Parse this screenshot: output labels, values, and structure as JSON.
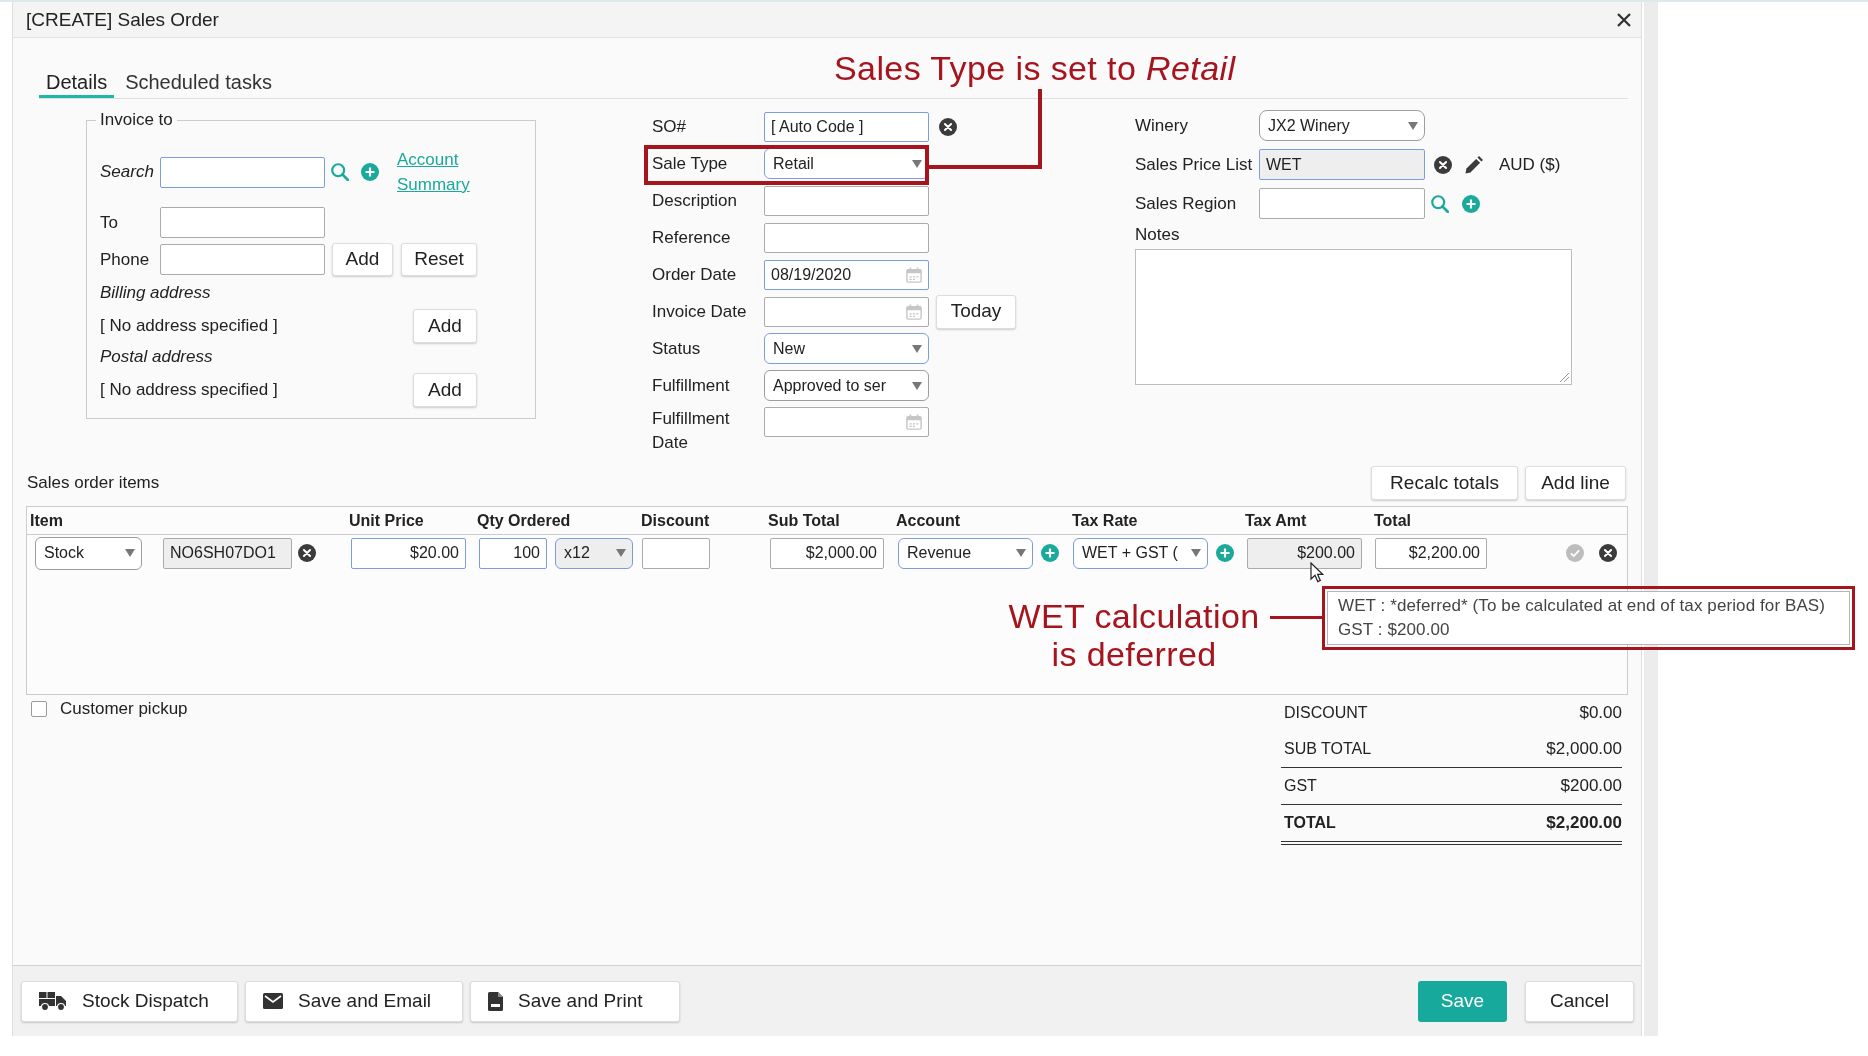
{
  "window": {
    "title": "[CREATE] Sales Order"
  },
  "tabs": [
    {
      "label": "Details",
      "selected": true
    },
    {
      "label": "Scheduled tasks",
      "selected": false
    }
  ],
  "annotations": {
    "sale_type": "Sales Type is set to *Retail*",
    "tax_amount": [
      "WET calculation",
      "is deferred"
    ]
  },
  "invoice_to": {
    "legend": "Invoice to",
    "search": {
      "label": "Search",
      "required": true,
      "link": "Account Summary"
    },
    "to": {
      "label": "To",
      "required": false
    },
    "phone": {
      "label": "Phone",
      "required": false,
      "buttons": [
        "Add",
        "Reset"
      ]
    },
    "addresses": [
      {
        "label": "Billing address",
        "value": "[ No address specified ]",
        "button": "Add"
      },
      {
        "label": "Postal address",
        "value": "[ No address specified ]",
        "button": "Add"
      }
    ]
  },
  "order_fields": [
    {
      "kind": "code",
      "label": "SO#",
      "value": "[ Auto Code ]",
      "required": true,
      "highlighted": false
    },
    {
      "kind": "select",
      "label": "Sale Type",
      "value": "Retail",
      "required": true,
      "highlighted": true
    },
    {
      "kind": "text",
      "label": "Description",
      "required": false,
      "highlighted": false
    },
    {
      "kind": "text",
      "label": "Reference",
      "required": false,
      "highlighted": false
    },
    {
      "kind": "date",
      "label": "Order Date",
      "value": "08/19/2020",
      "required": true,
      "highlighted": false
    },
    {
      "kind": "date",
      "label": "Invoice Date",
      "button": "Today",
      "required": false,
      "highlighted": false
    },
    {
      "kind": "select",
      "label": "Status",
      "value": "New",
      "required": true,
      "highlighted": false
    },
    {
      "kind": "select",
      "label": "Fulfillment",
      "value": "Approved to ser",
      "required": false,
      "highlighted": false
    },
    {
      "kind": "date",
      "label": "Fulfillment Date",
      "required": false,
      "highlighted": false
    }
  ],
  "settings_fields": [
    {
      "kind": "select",
      "label": "Winery",
      "value": "JX2 Winery",
      "required": false,
      "readonly": false
    },
    {
      "kind": "price_list",
      "label": "Sales Price List",
      "value": "WET",
      "suffix": "AUD ($)",
      "required": true,
      "readonly": true
    },
    {
      "kind": "lookup",
      "label": "Sales Region",
      "required": false,
      "readonly": false
    }
  ],
  "notes": {
    "label": "Notes"
  },
  "items": {
    "title": "Sales order items",
    "buttons": [
      "Recalc totals",
      "Add line"
    ],
    "columns": [
      "Item",
      "Unit Price",
      "Qty Ordered",
      "Discount",
      "Sub Total",
      "Account",
      "Tax Rate",
      "Tax Amt",
      "Total"
    ],
    "rows": [
      {
        "controls": [
          {
            "kind": "select",
            "value": "Stock",
            "required": false,
            "readonly": false
          },
          {
            "kind": "code",
            "value": "NO6SH07DO1",
            "required": false,
            "readonly": true
          },
          {
            "kind": "input",
            "value": "$20.00",
            "required": true,
            "readonly": false
          },
          {
            "kind": "input",
            "value": "100",
            "required": true,
            "readonly": false
          },
          {
            "kind": "select",
            "value": "x12",
            "required": true,
            "readonly": true
          },
          {
            "kind": "input",
            "required": false,
            "readonly": false
          },
          {
            "kind": "input",
            "value": "$2,000.00",
            "required": false,
            "readonly": false
          },
          {
            "kind": "select_add",
            "value": "Revenue",
            "required": true,
            "readonly": false
          },
          {
            "kind": "select_add",
            "value": "WET + GST (",
            "required": true,
            "readonly": false
          },
          {
            "kind": "input",
            "value": "$200.00",
            "required": false,
            "readonly": true
          },
          {
            "kind": "row_end",
            "value": "$2,200.00",
            "required": false,
            "readonly": false
          }
        ]
      }
    ]
  },
  "tooltip": {
    "lines": [
      "WET : *deferred* (To be calculated at end of tax period for BAS)",
      "GST : $200.00"
    ],
    "highlighted": true
  },
  "customer_pickup": {
    "label": "Customer pickup",
    "checked": false
  },
  "totals": [
    {
      "label": "DISCOUNT",
      "value": "$0.00",
      "kind": "plain"
    },
    {
      "label": "SUB TOTAL",
      "value": "$2,000.00",
      "kind": "ruled"
    },
    {
      "label": "GST",
      "value": "$200.00",
      "kind": "ruled"
    },
    {
      "label": "TOTAL",
      "value": "$2,200.00",
      "kind": "grand"
    }
  ],
  "footer": {
    "actions": [
      {
        "kind": "dispatch",
        "label": "Stock Dispatch"
      },
      {
        "kind": "email",
        "label": "Save and Email"
      },
      {
        "kind": "print",
        "label": "Save and Print"
      }
    ],
    "buttons": [
      {
        "kind": "primary",
        "label": "Save"
      },
      {
        "kind": "secondary",
        "label": "Cancel"
      }
    ]
  }
}
